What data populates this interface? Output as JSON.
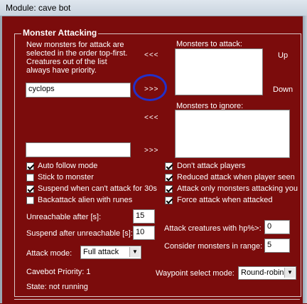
{
  "window": {
    "title": "Module: cave bot"
  },
  "group": {
    "title": "Monster Attacking"
  },
  "description": "New monsters for attack are selected in the order top-first. Creatures out of the list always have priority.",
  "monster_input": {
    "value": "cyclops"
  },
  "second_input": {
    "value": ""
  },
  "buttons": {
    "add_attack": "<<<",
    "remove_attack": ">>>",
    "add_ignore": "<<<",
    "remove_ignore": ">>>",
    "up": "Up",
    "down": "Down"
  },
  "lists": {
    "attack_label": "Monsters to attack:",
    "ignore_label": "Monsters to ignore:"
  },
  "checkboxes_left": [
    {
      "label": "Auto follow mode",
      "checked": true
    },
    {
      "label": "Stick to monster",
      "checked": false
    },
    {
      "label": "Suspend when can't attack for 30s",
      "checked": true
    },
    {
      "label": "Backattack alien with runes",
      "checked": false
    }
  ],
  "checkboxes_right": [
    {
      "label": "Don't attack players",
      "checked": true
    },
    {
      "label": "Reduced attack when player seen",
      "checked": true
    },
    {
      "label": "Attack only monsters attacking you",
      "checked": true
    },
    {
      "label": "Force attack when attacked",
      "checked": true
    }
  ],
  "fields": {
    "unreachable_label": "Unreachable after [s]:",
    "unreachable_value": "15",
    "suspend_label": "Suspend after unreachable [s]:",
    "suspend_value": "10",
    "attack_mode_label": "Attack mode:",
    "attack_mode_value": "Full attack",
    "hp_label": "Attack creatures with hp%>:",
    "hp_value": "0",
    "range_label": "Consider monsters in range:",
    "range_value": "5",
    "waypoint_label": "Waypoint select mode:",
    "waypoint_value": "Round-robin"
  },
  "status": {
    "priority": "Cavebot Priority: 1",
    "state": "State: not running"
  },
  "colors": {
    "background": "#7b0c0c",
    "highlight": "#2330c8"
  }
}
